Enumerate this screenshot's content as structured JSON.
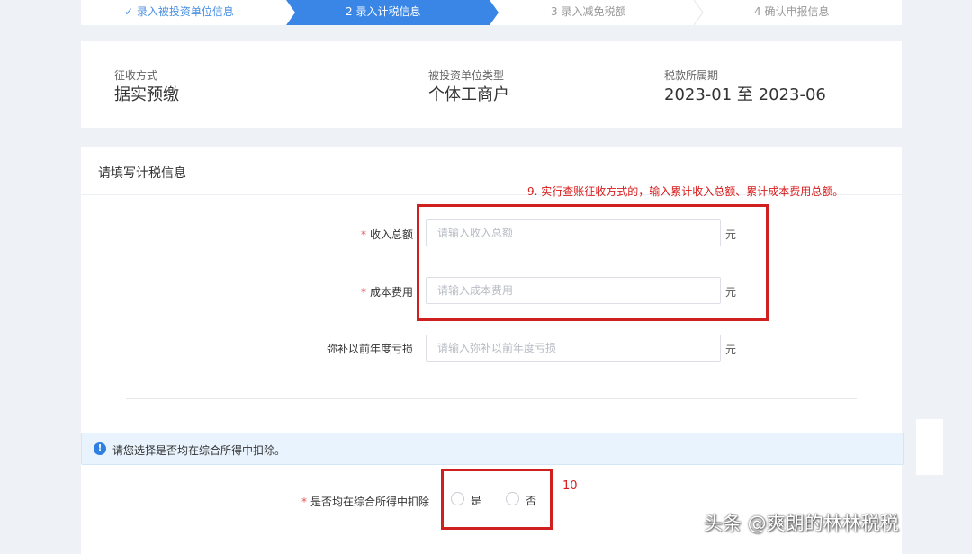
{
  "steps": [
    {
      "label": "✓ 录入被投资单位信息",
      "status": "done"
    },
    {
      "label": "2  录入计税信息",
      "status": "active"
    },
    {
      "label": "3  录入减免税额",
      "status": "pending"
    },
    {
      "label": "4  确认申报信息",
      "status": "pending"
    }
  ],
  "info": {
    "method_label": "征收方式",
    "method_value": "据实预缴",
    "type_label": "被投资单位类型",
    "type_value": "个体工商户",
    "period_label": "税款所属期",
    "period_value": "2023-01 至 2023-06"
  },
  "form": {
    "title": "请填写计税信息",
    "annotation_9": "9. 实行查账征收方式的，输入累计收入总额、累计成本费用总额。",
    "fields": [
      {
        "label": "收入总额",
        "required": true,
        "placeholder": "请输入收入总额",
        "value": "",
        "unit": "元"
      },
      {
        "label": "成本费用",
        "required": true,
        "placeholder": "请输入成本费用",
        "value": "",
        "unit": "元"
      },
      {
        "label": "弥补以前年度亏损",
        "required": false,
        "placeholder": "请输入弥补以前年度亏损",
        "value": "",
        "unit": "元"
      }
    ],
    "notice": "请您选择是否均在综合所得中扣除。",
    "notice_icon": "info-icon",
    "deduct": {
      "label": "是否均在综合所得中扣除",
      "required": true,
      "options": [
        "是",
        "否"
      ],
      "selected": null
    },
    "annotation_10": "10"
  },
  "watermark": "头条 @爽朗的林林税税",
  "colors": {
    "active_step": "#3a86e6",
    "annotation": "#d91b1b",
    "required": "#e35353",
    "notice_bg": "#e8f3fd"
  }
}
